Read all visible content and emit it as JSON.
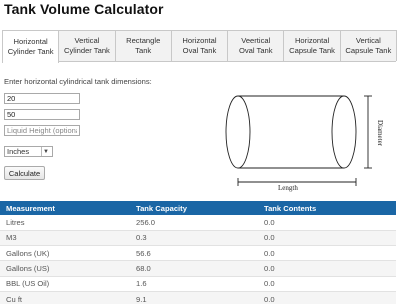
{
  "app": {
    "title": "Tank Volume Calculator"
  },
  "tabs": [
    {
      "line1": "Horizontal",
      "line2": "Cylinder Tank",
      "active": true
    },
    {
      "line1": "Vertical",
      "line2": "Cylinder Tank",
      "active": false
    },
    {
      "line1": "Rectangle",
      "line2": "Tank",
      "active": false
    },
    {
      "line1": "Horizontal",
      "line2": "Oval Tank",
      "active": false
    },
    {
      "line1": "Veertical",
      "line2": "Oval Tank",
      "active": false
    },
    {
      "line1": "Horizontal",
      "line2": "Capsule Tank",
      "active": false
    },
    {
      "line1": "Vertical",
      "line2": "Capsule Tank",
      "active": false
    }
  ],
  "form": {
    "instruction": "Enter horizontal cylindrical tank dimensions:",
    "diameter_value": "20",
    "length_value": "50",
    "liquid_height_value": "",
    "liquid_height_placeholder": "Liquid Height (optional)",
    "unit_selected": "Inches",
    "calculate_label": "Calculate"
  },
  "diagram": {
    "diameter_label": "Diameter",
    "length_label": "Length"
  },
  "results": {
    "headers": [
      "Measurement",
      "Tank Capacity",
      "Tank Contents"
    ],
    "rows": [
      [
        "Litres",
        "256.0",
        "0.0"
      ],
      [
        "M3",
        "0.3",
        "0.0"
      ],
      [
        "Gallons (UK)",
        "56.6",
        "0.0"
      ],
      [
        "Gallons (US)",
        "68.0",
        "0.0"
      ],
      [
        "BBL (US Oil)",
        "1.6",
        "0.0"
      ],
      [
        "Cu ft",
        "9.1",
        "0.0"
      ]
    ]
  },
  "colors": {
    "header_bg": "#1a66a5",
    "tab_bg": "#f2f2f2",
    "border": "#c8c8c8"
  }
}
